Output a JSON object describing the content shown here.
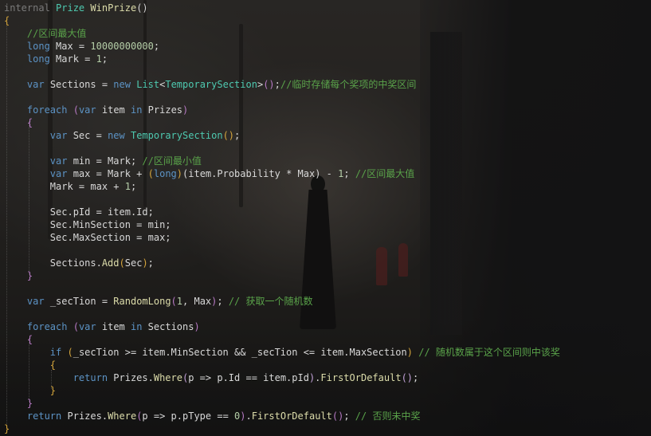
{
  "editor": {
    "lines": [
      [
        {
          "t": "internal",
          "c": "mod"
        },
        {
          "t": " "
        },
        {
          "t": "Prize",
          "c": "ty"
        },
        {
          "t": " "
        },
        {
          "t": "WinPrize",
          "c": "fn"
        },
        {
          "t": "()",
          "c": "pu"
        }
      ],
      [
        {
          "t": "{",
          "c": "bk2"
        }
      ],
      [
        {
          "t": "    "
        },
        {
          "t": "//区间最大值",
          "c": "cm"
        }
      ],
      [
        {
          "t": "    "
        },
        {
          "t": "long",
          "c": "kw"
        },
        {
          "t": " Max = "
        },
        {
          "t": "10000000000",
          "c": "num"
        },
        {
          "t": ";"
        }
      ],
      [
        {
          "t": "    "
        },
        {
          "t": "long",
          "c": "kw"
        },
        {
          "t": " Mark = "
        },
        {
          "t": "1",
          "c": "num"
        },
        {
          "t": ";"
        }
      ],
      [],
      [
        {
          "t": "    "
        },
        {
          "t": "var",
          "c": "kw"
        },
        {
          "t": " Sections = "
        },
        {
          "t": "new",
          "c": "kw"
        },
        {
          "t": " "
        },
        {
          "t": "List",
          "c": "ty"
        },
        {
          "t": "<"
        },
        {
          "t": "TemporarySection",
          "c": "ty"
        },
        {
          "t": ">"
        },
        {
          "t": "()",
          "c": "bk"
        },
        {
          "t": ";"
        },
        {
          "t": "//临时存储每个奖项的中奖区间",
          "c": "cm"
        }
      ],
      [],
      [
        {
          "t": "    "
        },
        {
          "t": "foreach",
          "c": "kw"
        },
        {
          "t": " "
        },
        {
          "t": "(",
          "c": "bk"
        },
        {
          "t": "var",
          "c": "kw"
        },
        {
          "t": " item "
        },
        {
          "t": "in",
          "c": "kw"
        },
        {
          "t": " Prizes"
        },
        {
          "t": ")",
          "c": "bk"
        }
      ],
      [
        {
          "t": "    "
        },
        {
          "t": "{",
          "c": "bk"
        }
      ],
      [
        {
          "t": "        "
        },
        {
          "t": "var",
          "c": "kw"
        },
        {
          "t": " Sec = "
        },
        {
          "t": "new",
          "c": "kw"
        },
        {
          "t": " "
        },
        {
          "t": "TemporarySection",
          "c": "ty"
        },
        {
          "t": "()",
          "c": "bk2"
        },
        {
          "t": ";"
        }
      ],
      [],
      [
        {
          "t": "        "
        },
        {
          "t": "var",
          "c": "kw"
        },
        {
          "t": " min = Mark; "
        },
        {
          "t": "//区间最小值",
          "c": "cm"
        }
      ],
      [
        {
          "t": "        "
        },
        {
          "t": "var",
          "c": "kw"
        },
        {
          "t": " max = Mark + "
        },
        {
          "t": "(",
          "c": "bk2"
        },
        {
          "t": "long",
          "c": "kw"
        },
        {
          "t": ")",
          "c": "bk2"
        },
        {
          "t": "("
        },
        {
          "t": "item.Probability * Max"
        },
        {
          "t": ")"
        },
        {
          "t": " - "
        },
        {
          "t": "1",
          "c": "num"
        },
        {
          "t": "; "
        },
        {
          "t": "//区间最大值",
          "c": "cm"
        }
      ],
      [
        {
          "t": "        "
        },
        {
          "t": "Mark = max + "
        },
        {
          "t": "1",
          "c": "num"
        },
        {
          "t": ";"
        }
      ],
      [],
      [
        {
          "t": "        "
        },
        {
          "t": "Sec.pId = item.Id;"
        }
      ],
      [
        {
          "t": "        "
        },
        {
          "t": "Sec.MinSection = min;"
        }
      ],
      [
        {
          "t": "        "
        },
        {
          "t": "Sec.MaxSection = max;"
        }
      ],
      [],
      [
        {
          "t": "        "
        },
        {
          "t": "Sections."
        },
        {
          "t": "Add",
          "c": "fn"
        },
        {
          "t": "(",
          "c": "bk2"
        },
        {
          "t": "Sec"
        },
        {
          "t": ")",
          "c": "bk2"
        },
        {
          "t": ";"
        }
      ],
      [
        {
          "t": "    "
        },
        {
          "t": "}",
          "c": "bk"
        }
      ],
      [],
      [
        {
          "t": "    "
        },
        {
          "t": "var",
          "c": "kw"
        },
        {
          "t": " _secTion = "
        },
        {
          "t": "RandomLong",
          "c": "fn"
        },
        {
          "t": "(",
          "c": "bk"
        },
        {
          "t": "1",
          "c": "num"
        },
        {
          "t": ", Max"
        },
        {
          "t": ")",
          "c": "bk"
        },
        {
          "t": "; "
        },
        {
          "t": "// 获取一个随机数",
          "c": "cm"
        }
      ],
      [],
      [
        {
          "t": "    "
        },
        {
          "t": "foreach",
          "c": "kw"
        },
        {
          "t": " "
        },
        {
          "t": "(",
          "c": "bk"
        },
        {
          "t": "var",
          "c": "kw"
        },
        {
          "t": " item "
        },
        {
          "t": "in",
          "c": "kw"
        },
        {
          "t": " Sections"
        },
        {
          "t": ")",
          "c": "bk"
        }
      ],
      [
        {
          "t": "    "
        },
        {
          "t": "{",
          "c": "bk"
        }
      ],
      [
        {
          "t": "        "
        },
        {
          "t": "if",
          "c": "kw"
        },
        {
          "t": " "
        },
        {
          "t": "(",
          "c": "bk2"
        },
        {
          "t": "_secTion >= item.MinSection && _secTion <= item.MaxSection"
        },
        {
          "t": ")",
          "c": "bk2"
        },
        {
          "t": " "
        },
        {
          "t": "// 随机数属于这个区间则中该奖",
          "c": "cm"
        }
      ],
      [
        {
          "t": "        "
        },
        {
          "t": "{",
          "c": "bk2"
        }
      ],
      [
        {
          "t": "            "
        },
        {
          "t": "return",
          "c": "kw"
        },
        {
          "t": " Prizes."
        },
        {
          "t": "Where",
          "c": "fn"
        },
        {
          "t": "(",
          "c": "bk3"
        },
        {
          "t": "p => p.Id == item.pId"
        },
        {
          "t": ")",
          "c": "bk3"
        },
        {
          "t": "."
        },
        {
          "t": "FirstOrDefault",
          "c": "fn"
        },
        {
          "t": "()",
          "c": "bk3"
        },
        {
          "t": ";"
        }
      ],
      [
        {
          "t": "        "
        },
        {
          "t": "}",
          "c": "bk2"
        }
      ],
      [
        {
          "t": "    "
        },
        {
          "t": "}",
          "c": "bk"
        }
      ],
      [
        {
          "t": "    "
        },
        {
          "t": "return",
          "c": "kw"
        },
        {
          "t": " Prizes."
        },
        {
          "t": "Where",
          "c": "fn"
        },
        {
          "t": "(",
          "c": "bk"
        },
        {
          "t": "p => p.pType == "
        },
        {
          "t": "0",
          "c": "num"
        },
        {
          "t": ")",
          "c": "bk"
        },
        {
          "t": "."
        },
        {
          "t": "FirstOrDefault",
          "c": "fn"
        },
        {
          "t": "()",
          "c": "bk"
        },
        {
          "t": "; "
        },
        {
          "t": "// 否则未中奖",
          "c": "cm"
        }
      ],
      [
        {
          "t": "}",
          "c": "bk2"
        }
      ]
    ]
  }
}
